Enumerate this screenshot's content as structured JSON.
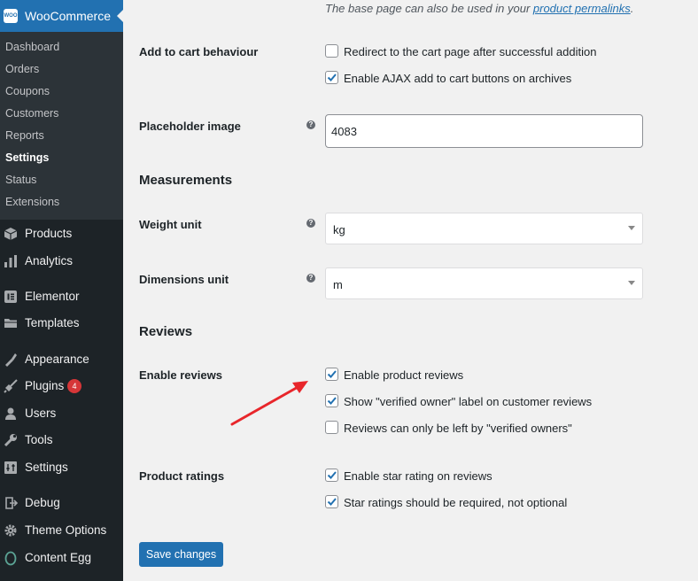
{
  "sidebar": {
    "header": {
      "logo": "WOO",
      "title": "WooCommerce"
    },
    "submenu": [
      "Dashboard",
      "Orders",
      "Coupons",
      "Customers",
      "Reports",
      "Settings",
      "Status",
      "Extensions"
    ],
    "menu": [
      {
        "label": "Products",
        "icon": "products-icon"
      },
      {
        "label": "Analytics",
        "icon": "analytics-icon"
      },
      {
        "label": "Elementor",
        "icon": "elementor-icon"
      },
      {
        "label": "Templates",
        "icon": "folder-icon"
      },
      {
        "label": "Appearance",
        "icon": "appearance-icon"
      },
      {
        "label": "Plugins",
        "icon": "plugin-icon",
        "badge": "4"
      },
      {
        "label": "Users",
        "icon": "users-icon"
      },
      {
        "label": "Tools",
        "icon": "wrench-icon"
      },
      {
        "label": "Settings",
        "icon": "settings-icon"
      },
      {
        "label": "Debug",
        "icon": "debug-icon"
      },
      {
        "label": "Theme Options",
        "icon": "gear-icon"
      },
      {
        "label": "Content Egg",
        "icon": "egg-icon"
      }
    ]
  },
  "main": {
    "note": {
      "text": "The base page can also be used in your ",
      "link": "product permalinks",
      "end": "."
    },
    "add_to_cart": {
      "label": "Add to cart behaviour",
      "options": [
        {
          "label": "Redirect to the cart page after successful addition",
          "checked": false
        },
        {
          "label": "Enable AJAX add to cart buttons on archives",
          "checked": true
        }
      ]
    },
    "placeholder_image": {
      "label": "Placeholder image",
      "value": "4083",
      "help": "?"
    },
    "measurements": {
      "title": "Measurements",
      "weight_unit": {
        "label": "Weight unit",
        "value": "kg"
      },
      "dimensions_unit": {
        "label": "Dimensions unit",
        "value": "m"
      }
    },
    "reviews": {
      "title": "Reviews",
      "enable_reviews": {
        "label": "Enable reviews",
        "options": [
          {
            "label": "Enable product reviews",
            "checked": true
          },
          {
            "label": "Show \"verified owner\" label on customer reviews",
            "checked": true
          },
          {
            "label": "Reviews can only be left by \"verified owners\"",
            "checked": false
          }
        ]
      },
      "product_ratings": {
        "label": "Product ratings",
        "options": [
          {
            "label": "Enable star rating on reviews",
            "checked": true
          },
          {
            "label": "Star ratings should be required, not optional",
            "checked": true
          }
        ]
      }
    },
    "save_label": "Save changes"
  },
  "colors": {
    "accent": "#2271b1",
    "sidebar": "#1d2327",
    "submenu": "#2c3338",
    "annotation_arrow": "#e8262b"
  }
}
